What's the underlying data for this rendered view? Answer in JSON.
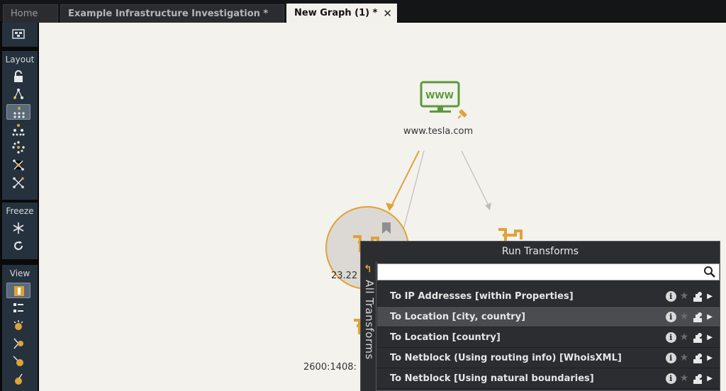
{
  "tabs": [
    {
      "label": "Home"
    },
    {
      "label": "Example Infrastructure Investigation *"
    },
    {
      "label": "New Graph (1) *"
    }
  ],
  "sidebar": {
    "layout_title": "Layout",
    "freeze_title": "Freeze",
    "view_title": "View"
  },
  "graph": {
    "nodes": [
      {
        "label": "www.tesla.com"
      },
      {
        "label": "23.22"
      },
      {
        "label": "2600:1408:"
      }
    ]
  },
  "transforms_panel": {
    "title": "Run Transforms",
    "category_tab": "All Transforms",
    "search_value": "",
    "items": [
      {
        "label": "To IP Addresses [within Properties]",
        "highlighted": false
      },
      {
        "label": "To Location [city, country]",
        "highlighted": true
      },
      {
        "label": "To Location [country]",
        "highlighted": false
      },
      {
        "label": "To Netblock (Using routing info) [WhoisXML]",
        "highlighted": false
      },
      {
        "label": "To Netblock [Using natural boundaries]",
        "highlighted": false
      }
    ]
  },
  "colors": {
    "accent": "#e0a238",
    "website_green": "#5a9a3a",
    "panel_bg": "#2b2d31",
    "canvas_bg": "#f4f2ed"
  },
  "icons": {
    "info": "i",
    "star": "★",
    "run": "▶",
    "back": "↰",
    "close": "✕"
  }
}
